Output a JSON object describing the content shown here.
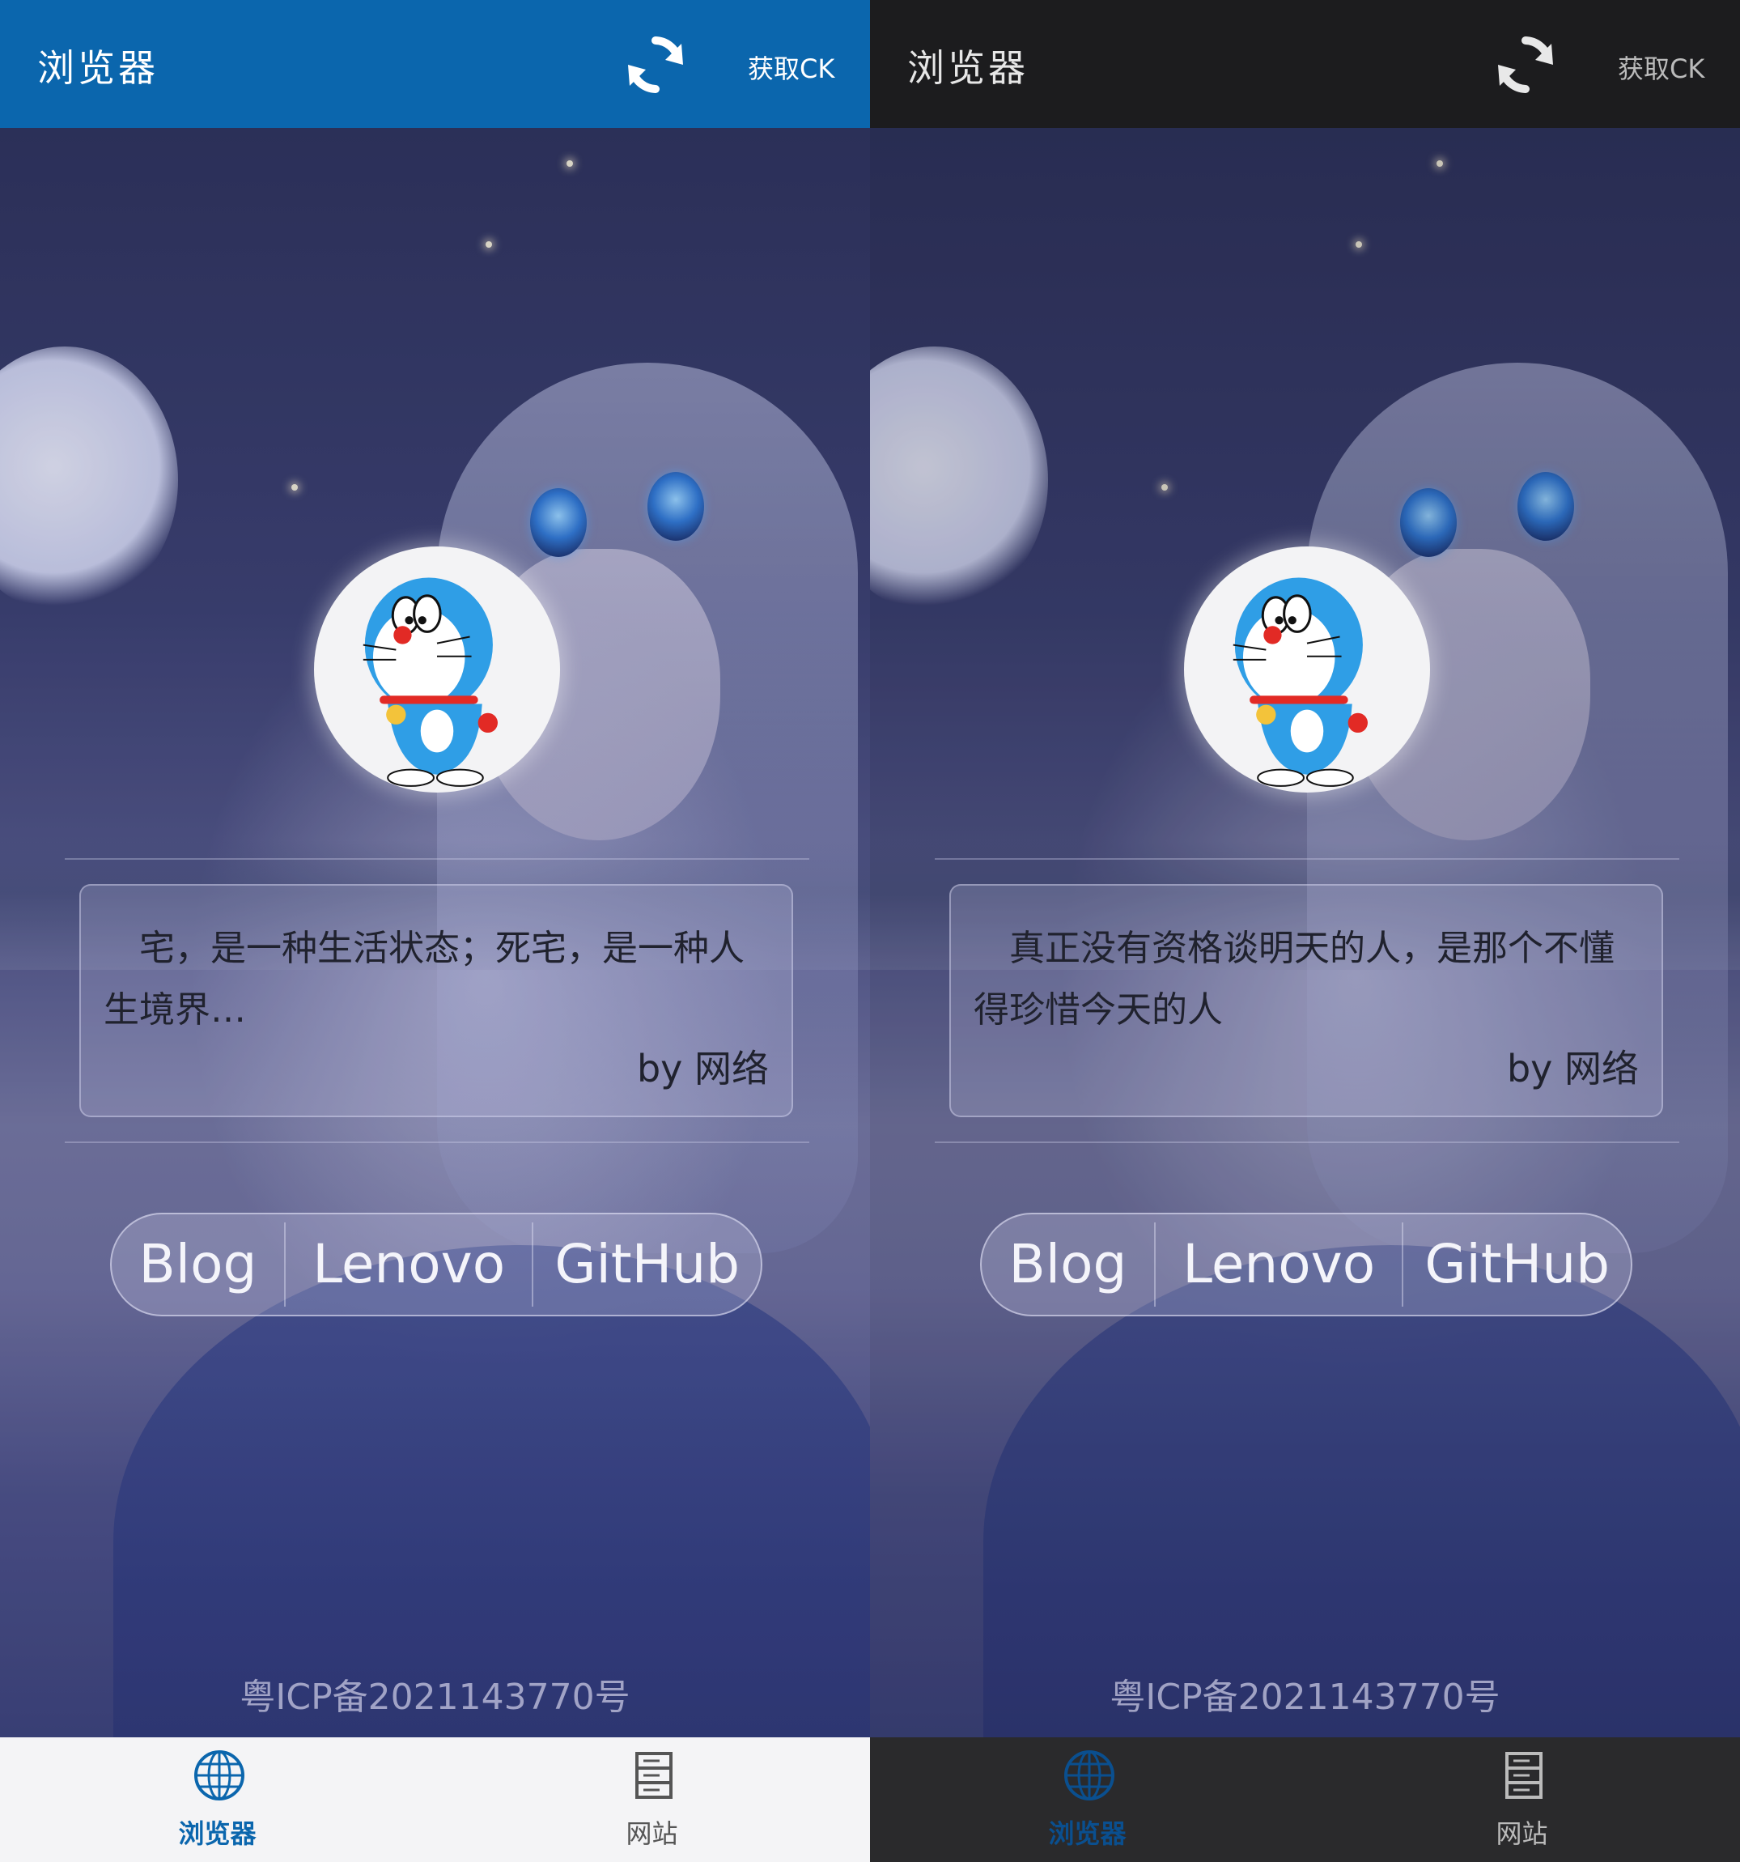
{
  "colors": {
    "light_topbar": "#0b66ad",
    "dark_topbar": "#1c1c1e",
    "accent": "#0b66ad",
    "light_navbar": "#f4f4f6",
    "dark_navbar": "#2a2a2c"
  },
  "screens": [
    {
      "theme": "light",
      "header": {
        "title": "浏览器",
        "refresh_icon": "refresh-icon",
        "get_ck_label": "获取CK"
      },
      "quote": {
        "text": "宅，是一种生活状态；死宅，是一种人生境界…",
        "by": "by 网络"
      },
      "links": [
        "Blog",
        "Lenovo",
        "GitHub"
      ],
      "footer": {
        "icp": "粤ICP备2021143770号"
      },
      "nav": [
        {
          "label": "浏览器",
          "icon": "globe-icon",
          "active": true
        },
        {
          "label": "网站",
          "icon": "server-list-icon",
          "active": false
        }
      ]
    },
    {
      "theme": "dark",
      "header": {
        "title": "浏览器",
        "refresh_icon": "refresh-icon",
        "get_ck_label": "获取CK"
      },
      "quote": {
        "text": "真正没有资格谈明天的人，是那个不懂得珍惜今天的人",
        "by": "by 网络"
      },
      "links": [
        "Blog",
        "Lenovo",
        "GitHub"
      ],
      "footer": {
        "icp": "粤ICP备2021143770号"
      },
      "nav": [
        {
          "label": "浏览器",
          "icon": "globe-icon",
          "active": true
        },
        {
          "label": "网站",
          "icon": "server-list-icon",
          "active": false
        }
      ]
    }
  ]
}
